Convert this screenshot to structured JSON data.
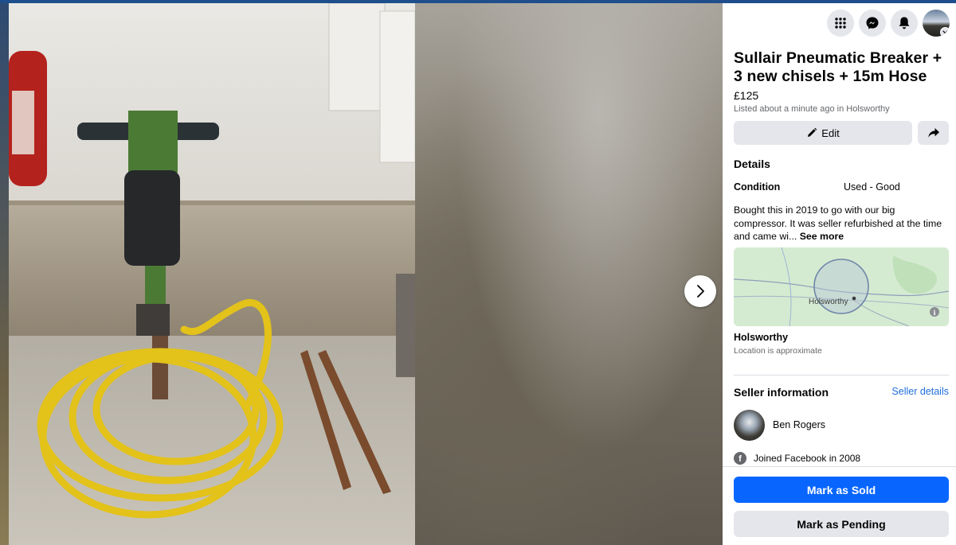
{
  "listing": {
    "title": "Sullair Pneumatic Breaker + 3 new chisels + 15m Hose",
    "price": "£125",
    "listed": "Listed about a minute ago in Holsworthy",
    "edit_label": "Edit",
    "details_heading": "Details",
    "condition_label": "Condition",
    "condition_value": "Used - Good",
    "description": "Bought this in 2019 to go with our big compressor. It was seller refurbished at the time and came wi...",
    "see_more": "See more",
    "map_label": "Holsworthy",
    "location_name": "Holsworthy",
    "location_note": "Location is approximate"
  },
  "seller": {
    "heading": "Seller information",
    "details_link": "Seller details",
    "name": "Ben Rogers",
    "joined": "Joined Facebook in 2008"
  },
  "footer": {
    "mark_sold": "Mark as Sold",
    "mark_pending": "Mark as Pending"
  },
  "icons": {
    "menu": "grid-icon",
    "messenger": "messenger-icon",
    "notifications": "bell-icon",
    "next": "chevron-right-icon",
    "edit": "pencil-icon",
    "share": "share-icon",
    "info": "info-icon",
    "facebook": "facebook-icon"
  },
  "colors": {
    "primary_button": "#0866ff",
    "secondary_button": "#e4e6eb",
    "link": "#216fdb",
    "muted_text": "#65676b"
  }
}
